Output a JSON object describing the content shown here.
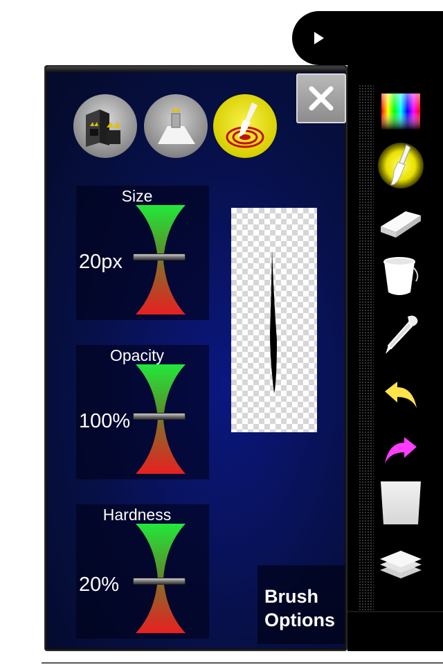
{
  "panel": {
    "title": "Brush\nOptions",
    "close_icon": "close-icon",
    "modes": [
      {
        "name": "gift-boxes-mode-icon"
      },
      {
        "name": "gift-platform-mode-icon"
      },
      {
        "name": "brush-target-mode-icon",
        "active": true
      }
    ],
    "sliders": [
      {
        "label": "Size",
        "value": "20px"
      },
      {
        "label": "Opacity",
        "value": "100%"
      },
      {
        "label": "Hardness",
        "value": "20%"
      }
    ]
  },
  "toolbar": {
    "tools": [
      "color-palette-icon",
      "brush-icon",
      "eraser-icon",
      "bucket-icon",
      "eyedropper-icon",
      "undo-icon",
      "redo-icon",
      "canvas-icon",
      "layers-icon"
    ],
    "active_tool": "brush-icon"
  },
  "colors": {
    "panel_bg": "#071047",
    "slider_top": "#22e83a",
    "slider_bottom": "#e82020",
    "undo": "#ffe34a",
    "redo": "#ff3cff"
  }
}
